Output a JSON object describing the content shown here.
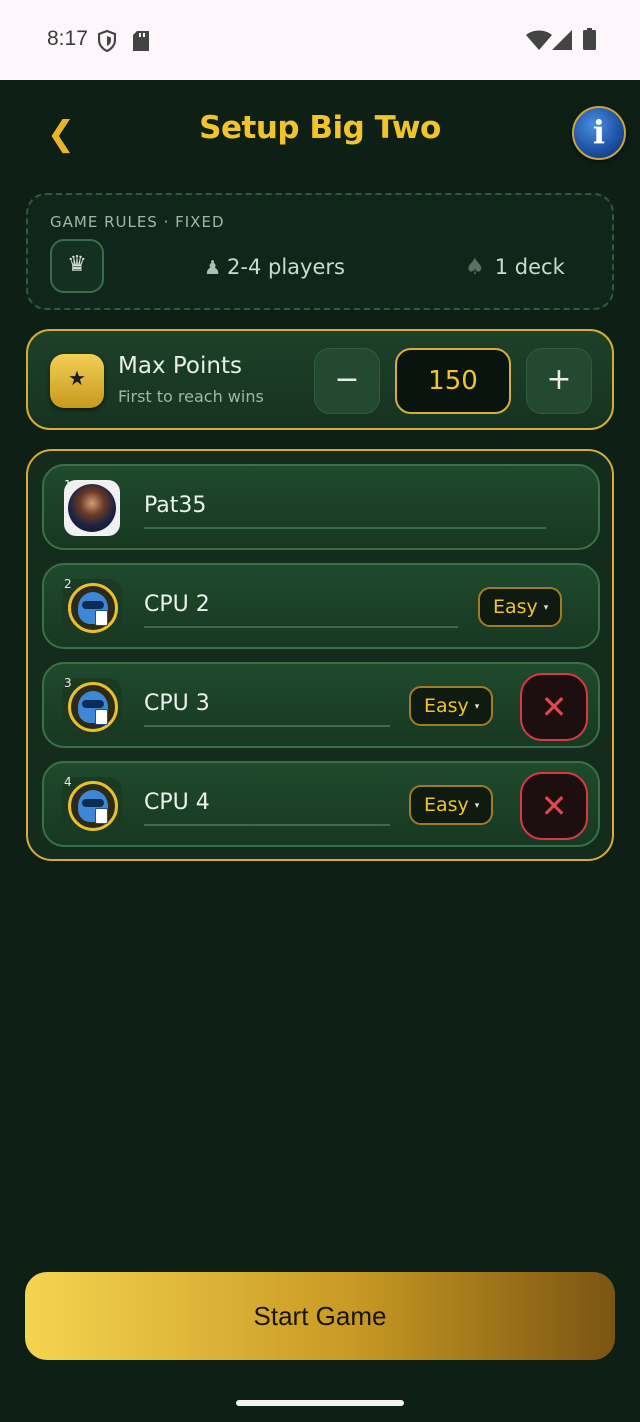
{
  "status_bar": {
    "time": "8:17",
    "left_icons": [
      "shield-icon",
      "sd-card-icon"
    ],
    "right_icons": [
      "wifi-icon",
      "signal-icon",
      "battery-icon"
    ]
  },
  "header": {
    "back_icon": "❮",
    "title": "Setup Big Two",
    "info_icon": "i"
  },
  "rules": {
    "label": "GAME RULES · FIXED",
    "crown_icon": "♛",
    "players_icon": "♟",
    "players": "2-4 players",
    "deck_icon": "♠",
    "deck": "1 deck"
  },
  "points": {
    "star_icon": "★",
    "title": "Max Points",
    "subtitle": "First to reach wins",
    "minus": "−",
    "value": "150",
    "plus": "+"
  },
  "players": [
    {
      "num": "1",
      "name": "Pat35",
      "type": "human"
    },
    {
      "num": "2",
      "name": "CPU 2",
      "difficulty": "Easy",
      "caret": "▾",
      "type": "cpu",
      "removable": false
    },
    {
      "num": "3",
      "name": "CPU 3",
      "difficulty": "Easy",
      "caret": "▾",
      "type": "cpu",
      "removable": true
    },
    {
      "num": "4",
      "name": "CPU 4",
      "difficulty": "Easy",
      "caret": "▾",
      "type": "cpu",
      "removable": true
    }
  ],
  "remove_icon": "✕",
  "start_button": "Start Game",
  "colors": {
    "background": "#0e2016",
    "accent_gold": "#f0c42a",
    "card_border": "#d6ad3a",
    "remove_red": "#d63a44"
  }
}
